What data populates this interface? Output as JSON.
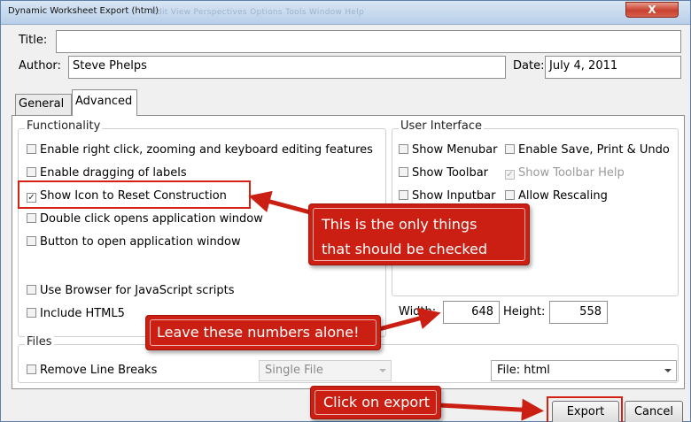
{
  "window": {
    "title": "Dynamic Worksheet Export (html)",
    "ghost_menu": "Edit  View  Perspectives  Options  Tools  Window  Help",
    "close_label": "X"
  },
  "form": {
    "title_label": "Title:",
    "title_value": "",
    "author_label": "Author:",
    "author_value": "Steve Phelps",
    "date_label": "Date:",
    "date_value": "July 4, 2011"
  },
  "tabs": [
    {
      "label": "General",
      "active": false
    },
    {
      "label": "Advanced",
      "active": true
    }
  ],
  "functionality": {
    "heading": "Functionality",
    "items": [
      {
        "label": "Enable right click, zooming and keyboard editing features",
        "checked": false
      },
      {
        "label": "Enable dragging of labels",
        "checked": false
      },
      {
        "label": "Show Icon to Reset Construction",
        "checked": true
      },
      {
        "label": "Double click opens application window",
        "checked": false
      },
      {
        "label": "Button to open application window",
        "checked": false
      },
      {
        "label": "Use Browser for JavaScript scripts",
        "checked": false
      },
      {
        "label": "Include HTML5",
        "checked": false
      }
    ]
  },
  "user_interface": {
    "heading": "User Interface",
    "items": [
      {
        "label": "Show Menubar",
        "checked": false,
        "enabled": true
      },
      {
        "label": "Enable Save, Print & Undo",
        "checked": false,
        "enabled": true
      },
      {
        "label": "Show Toolbar",
        "checked": false,
        "enabled": true
      },
      {
        "label": "Show Toolbar Help",
        "checked": true,
        "enabled": false
      },
      {
        "label": "Show Inputbar",
        "checked": false,
        "enabled": true
      },
      {
        "label": "Allow Rescaling",
        "checked": false,
        "enabled": true
      }
    ],
    "width_label": "Width:",
    "width_value": "648",
    "height_label": "Height:",
    "height_value": "558"
  },
  "files": {
    "heading": "Files",
    "remove_line_breaks": {
      "label": "Remove Line Breaks",
      "checked": false
    },
    "file_mode": {
      "value": "Single File",
      "enabled": false
    },
    "file_type": {
      "value": "File: html",
      "enabled": true
    }
  },
  "buttons": {
    "export": "Export",
    "cancel": "Cancel"
  },
  "annotations": {
    "callout_checked_line1": "This is the only things",
    "callout_checked_line2": "that should be checked",
    "callout_numbers": "Leave these numbers alone!",
    "callout_export": "Click on export",
    "color": "#ca1f12"
  }
}
